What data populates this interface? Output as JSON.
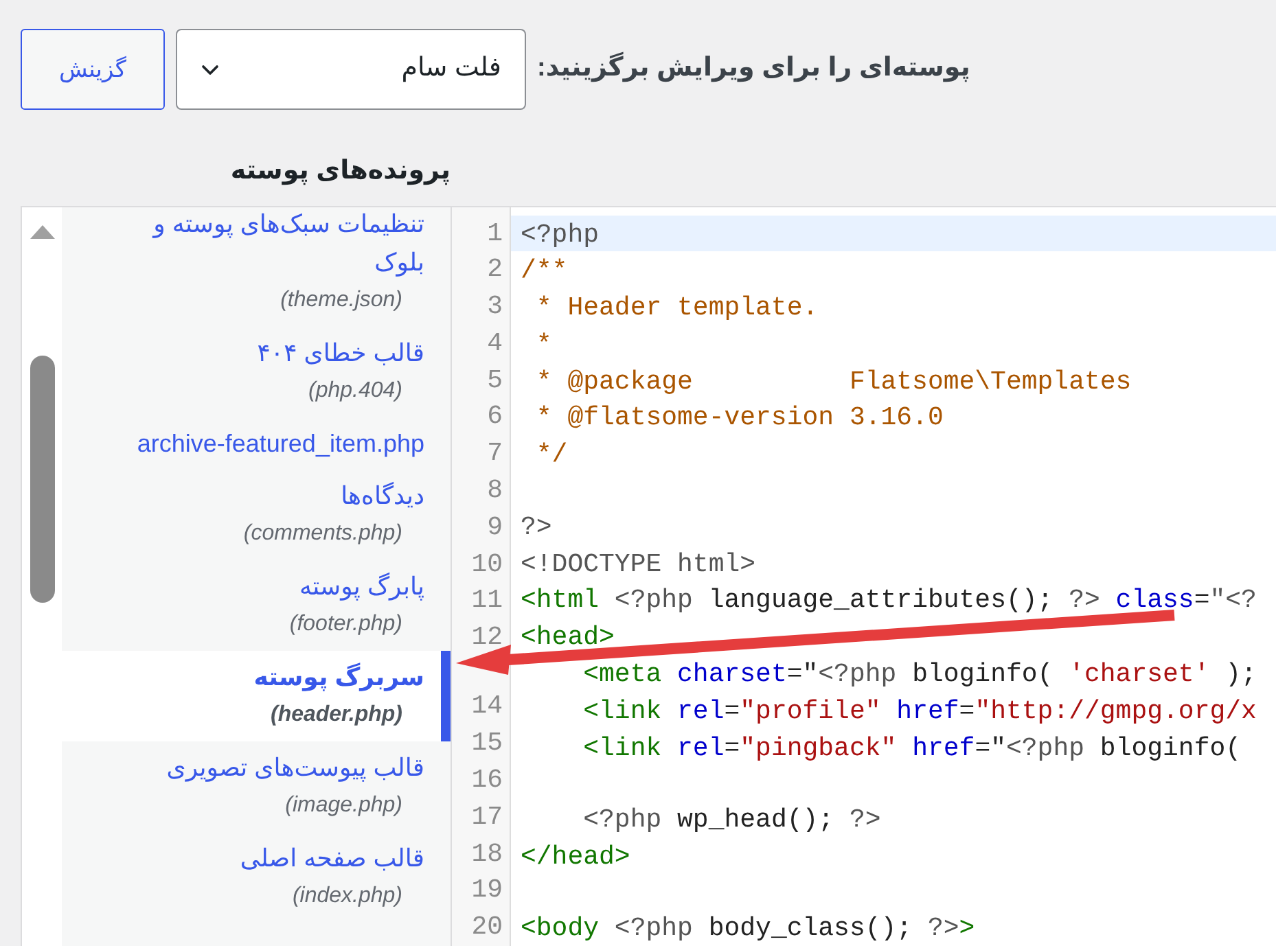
{
  "theme_picker": {
    "label": "پوسته‌ای را برای ویرایش برگزینید:",
    "select": {
      "value": "فلت سام"
    },
    "button": "گزینش"
  },
  "files": {
    "title": "پرونده‌های پوسته",
    "items": [
      {
        "name": "تنظیمات سبک‌های پوسته و بلوک",
        "file": "(theme.json)",
        "selected": false
      },
      {
        "name": "قالب خطای ۴۰۴",
        "file": "(php.404)",
        "selected": false
      },
      {
        "name": "archive-featured_item.php",
        "selected": false
      },
      {
        "name": "دیدگاه‌ها",
        "file": "(comments.php)",
        "selected": false
      },
      {
        "name": "پابرگ پوسته",
        "file": "(footer.php)",
        "selected": false
      },
      {
        "name": "سربرگ پوسته",
        "file": "(header.php)",
        "selected": true
      },
      {
        "name": "قالب پیوست‌های تصویری",
        "file": "(image.php)",
        "selected": false
      },
      {
        "name": "قالب صفحه اصلی",
        "file": "(index.php)",
        "selected": false
      }
    ]
  },
  "editor": {
    "lines": [
      {
        "number": "1",
        "active": true,
        "tokens": [
          {
            "kind": "meta",
            "text": "<?php"
          }
        ]
      },
      {
        "number": "2",
        "active": false,
        "tokens": [
          {
            "kind": "comment",
            "text": "/**"
          }
        ]
      },
      {
        "number": "3",
        "active": false,
        "tokens": [
          {
            "kind": "comment",
            "text": " * Header template."
          }
        ]
      },
      {
        "number": "4",
        "active": false,
        "tokens": [
          {
            "kind": "comment",
            "text": " *"
          }
        ]
      },
      {
        "number": "5",
        "active": false,
        "tokens": [
          {
            "kind": "comment",
            "text": " * @package          Flatsome\\Templates"
          }
        ]
      },
      {
        "number": "6",
        "active": false,
        "tokens": [
          {
            "kind": "comment",
            "text": " * @flatsome-version 3.16.0"
          }
        ]
      },
      {
        "number": "7",
        "active": false,
        "tokens": [
          {
            "kind": "comment",
            "text": " */"
          }
        ]
      },
      {
        "number": "8",
        "active": false
      },
      {
        "number": "9",
        "active": false,
        "tokens": [
          {
            "kind": "meta",
            "text": "?>"
          }
        ]
      },
      {
        "number": "10",
        "active": false,
        "tokens": [
          {
            "kind": "meta",
            "text": "<!DOCTYPE html>"
          }
        ]
      },
      {
        "number": "11",
        "active": false,
        "tokens": [
          {
            "kind": "tag",
            "text": "<html"
          },
          {
            "kind": "meta",
            "text": " <?php"
          },
          {
            "kind": "plain",
            "text": " language_attributes(); "
          },
          {
            "kind": "meta",
            "text": "?>"
          },
          {
            "kind": "attribute",
            "text": " class"
          },
          {
            "kind": "plain",
            "text": "="
          },
          {
            "kind": "meta",
            "text": "\"<?"
          }
        ]
      },
      {
        "number": "12",
        "active": false,
        "tokens": [
          {
            "kind": "tag",
            "text": "<head>"
          }
        ]
      },
      {
        "active": false,
        "tokens": [
          {
            "kind": "tag",
            "text": "    <meta"
          },
          {
            "kind": "attribute",
            "text": " charset"
          },
          {
            "kind": "plain",
            "text": "=\""
          },
          {
            "kind": "meta",
            "text": "<?php"
          },
          {
            "kind": "plain",
            "text": " bloginfo( "
          },
          {
            "kind": "string",
            "text": "'charset'"
          },
          {
            "kind": "plain",
            "text": " );"
          }
        ]
      },
      {
        "number": "14",
        "active": false,
        "tokens": [
          {
            "kind": "tag",
            "text": "    <link"
          },
          {
            "kind": "attribute",
            "text": " rel"
          },
          {
            "kind": "plain",
            "text": "="
          },
          {
            "kind": "string",
            "text": "\"profile\""
          },
          {
            "kind": "attribute",
            "text": " href"
          },
          {
            "kind": "plain",
            "text": "="
          },
          {
            "kind": "string",
            "text": "\"http://gmpg.org/x"
          }
        ]
      },
      {
        "number": "15",
        "active": false,
        "tokens": [
          {
            "kind": "tag",
            "text": "    <link"
          },
          {
            "kind": "attribute",
            "text": " rel"
          },
          {
            "kind": "plain",
            "text": "="
          },
          {
            "kind": "string",
            "text": "\"pingback\""
          },
          {
            "kind": "attribute",
            "text": " href"
          },
          {
            "kind": "plain",
            "text": "=\""
          },
          {
            "kind": "meta",
            "text": "<?php"
          },
          {
            "kind": "plain",
            "text": " bloginfo("
          }
        ]
      },
      {
        "number": "16",
        "active": false
      },
      {
        "number": "17",
        "active": false,
        "tokens": [
          {
            "kind": "meta",
            "text": "    <?php"
          },
          {
            "kind": "plain",
            "text": " wp_head(); "
          },
          {
            "kind": "meta",
            "text": "?>"
          }
        ]
      },
      {
        "number": "18",
        "active": false,
        "tokens": [
          {
            "kind": "tag",
            "text": "</head>"
          }
        ]
      },
      {
        "number": "19",
        "active": false
      },
      {
        "number": "20",
        "active": false,
        "tokens": [
          {
            "kind": "tag",
            "text": "<body"
          },
          {
            "kind": "meta",
            "text": " <?php"
          },
          {
            "kind": "plain",
            "text": " body_class(); "
          },
          {
            "kind": "meta",
            "text": "?>"
          },
          {
            "kind": "tag",
            "text": ">"
          }
        ]
      }
    ]
  }
}
